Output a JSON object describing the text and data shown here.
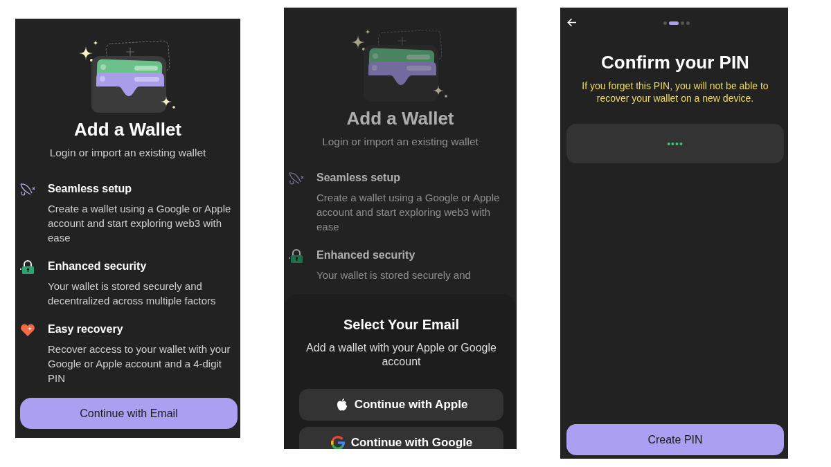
{
  "screens": [
    {
      "kind": "intro",
      "dimmed": false,
      "title": "Add a Wallet",
      "subtitle": "Login or import an existing wallet",
      "features": [
        {
          "title": "Seamless setup",
          "description": "Create a wallet using a Google or Apple account and start exploring web3 with ease"
        },
        {
          "title": "Enhanced security",
          "description": "Your wallet is stored securely and decentralized across multiple factors"
        },
        {
          "title": "Easy recovery",
          "description": "Recover access to your wallet with your Google or Apple account and a 4-digit PIN"
        }
      ],
      "button": "Continue with Email"
    },
    {
      "kind": "intro",
      "dimmed": true,
      "title": "Add a Wallet",
      "subtitle": "Login or import an existing wallet",
      "features": [
        {
          "title": "Seamless setup",
          "description": "Create a wallet using a Google or Apple account and start exploring web3 with ease"
        },
        {
          "title": "Enhanced security",
          "description": "Your wallet is stored securely and"
        }
      ],
      "sheet": {
        "title": "Select Your Email",
        "subtitle": "Add a wallet with your Apple or Google account",
        "buttons": [
          {
            "kind": "apple",
            "label": "Continue with Apple"
          },
          {
            "kind": "google",
            "label": "Continue with Google"
          }
        ]
      }
    },
    {
      "kind": "pin",
      "steps": [
        {
          "selected": false
        },
        {
          "selected": true
        },
        {
          "selected": false
        },
        {
          "selected": false
        }
      ],
      "title": "Confirm your PIN",
      "warning": "If you forget this PIN, you will not be able to recover your wallet on a new device.",
      "pin_value": "••••",
      "button": "Create PIN"
    }
  ]
}
